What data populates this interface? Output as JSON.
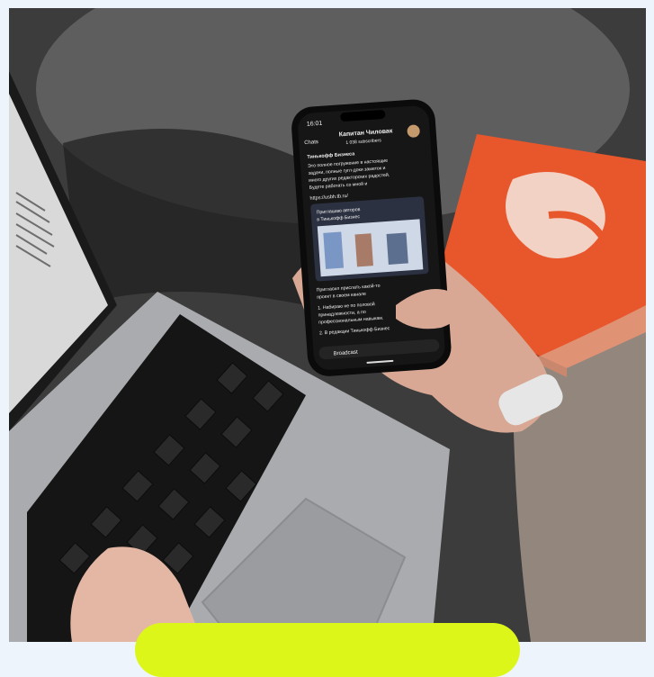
{
  "phone": {
    "status_time": "16:01",
    "channel_name": "Капитан Чиловак",
    "subscribers": "1 038 subscribers",
    "back_label": "Chats",
    "sender": "Тинькофф Бизнеса",
    "post_lines": [
      "Это полное погружение в настоящие",
      "задачи, полные гугл-доки заметок и",
      "много других редакторских радостей.",
      "Будете работать со мной и"
    ],
    "link_text": "https://usbh.tb.ru/",
    "card_lines": [
      "Приглашаю авторов",
      "в Тинькофф Бизнес"
    ],
    "second_post_lines": [
      "Пригласил прислать какой-то",
      "проект в своем канале",
      "1. Набираю не по половой",
      "принадлежности, а по",
      "профессиональным навыкам.",
      "2. В редакции Тинькофф Бизнес"
    ],
    "input_placeholder": "Broadcast"
  },
  "colors": {
    "cta": "#ddf61a",
    "book": "#e8572c",
    "page_bg": "#eef4fb"
  }
}
